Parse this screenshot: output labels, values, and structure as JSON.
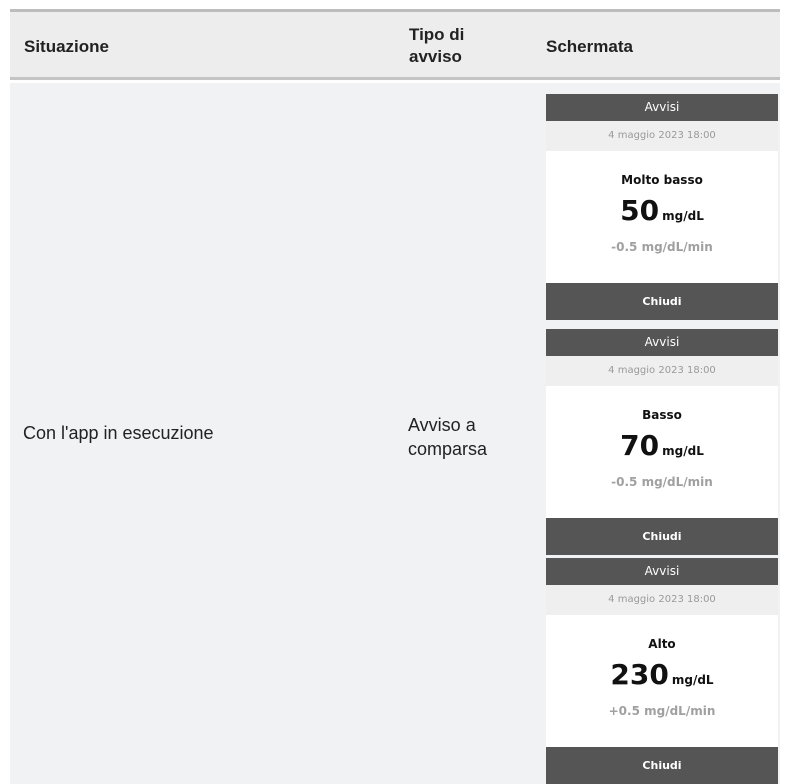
{
  "header": {
    "situazione": "Situazione",
    "tipo": "Tipo di avviso",
    "schermata": "Schermata"
  },
  "row": {
    "situazione": "Con l'app in esecuzione",
    "tipo": "Avviso a comparsa",
    "screens": [
      {
        "title": "Avvisi",
        "date": "4 maggio 2023 18:00",
        "level": "Molto basso",
        "value": "50",
        "unit": "mg/dL",
        "rate": "-0.5 mg/dL/min",
        "button": "Chiudi"
      },
      {
        "title": "Avvisi",
        "date": "4 maggio 2023 18:00",
        "level": "Basso",
        "value": "70",
        "unit": "mg/dL",
        "rate": "-0.5 mg/dL/min",
        "button": "Chiudi"
      },
      {
        "title": "Avvisi",
        "date": "4 maggio 2023 18:00",
        "level": "Alto",
        "value": "230",
        "unit": "mg/dL",
        "rate": "+0.5 mg/dL/min",
        "button": "Chiudi"
      }
    ]
  },
  "colors": {
    "header_bg": "#ededed",
    "body_bg": "#f1f2f4",
    "screen_bar": "#555555",
    "date_bar": "#efefef"
  }
}
